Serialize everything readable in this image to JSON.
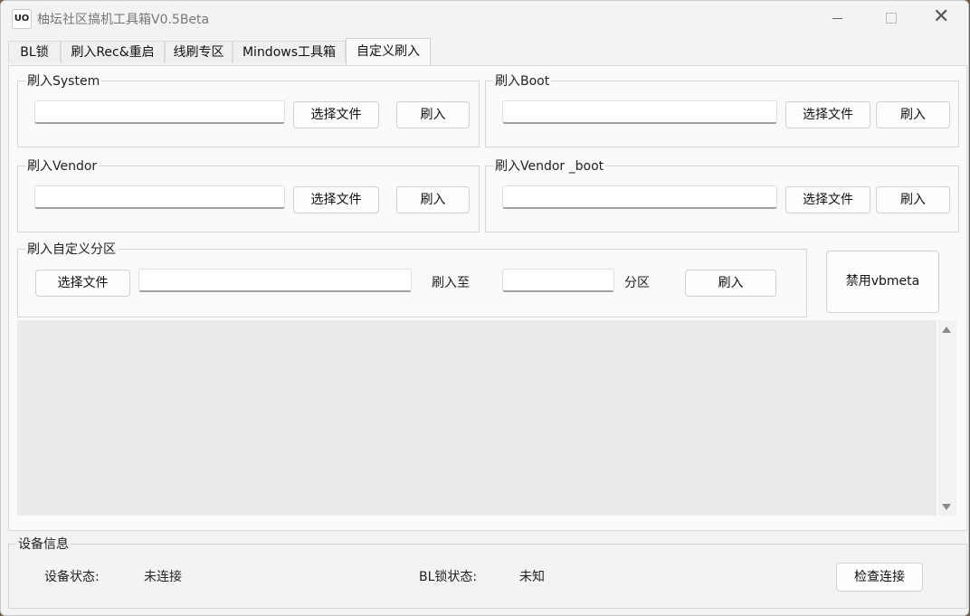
{
  "window": {
    "title": "柚坛社区搞机工具箱V0.5Beta",
    "icon_text": "UO",
    "close_glyph": "✕"
  },
  "tabs": [
    {
      "label": "BL锁"
    },
    {
      "label": "刷入Rec&重启"
    },
    {
      "label": "线刷专区"
    },
    {
      "label": "Mindows工具箱"
    },
    {
      "label": "自定义刷入",
      "active": true
    }
  ],
  "flash_system": {
    "legend": "刷入System",
    "select_label": "选择文件",
    "flash_label": "刷入",
    "path_value": ""
  },
  "flash_boot": {
    "legend": "刷入Boot",
    "select_label": "选择文件",
    "flash_label": "刷入",
    "path_value": ""
  },
  "flash_vendor": {
    "legend": "刷入Vendor",
    "select_label": "选择文件",
    "flash_label": "刷入",
    "path_value": ""
  },
  "flash_vendor_boot": {
    "legend": "刷入Vendor _boot",
    "select_label": "选择文件",
    "flash_label": "刷入",
    "path_value": ""
  },
  "custom_partition": {
    "legend": "刷入自定义分区",
    "select_label": "选择文件",
    "path_value": "",
    "to_label": "刷入至",
    "partition_value": "",
    "partition_label": "分区",
    "flash_label": "刷入"
  },
  "disable_vbmeta_label": "禁用vbmeta",
  "log_text": "",
  "device_info": {
    "legend": "设备信息",
    "status_label": "设备状态:",
    "status_value": "未连接",
    "bl_label": "BL锁状态:",
    "bl_value": "未知",
    "check_label": "检查连接"
  }
}
